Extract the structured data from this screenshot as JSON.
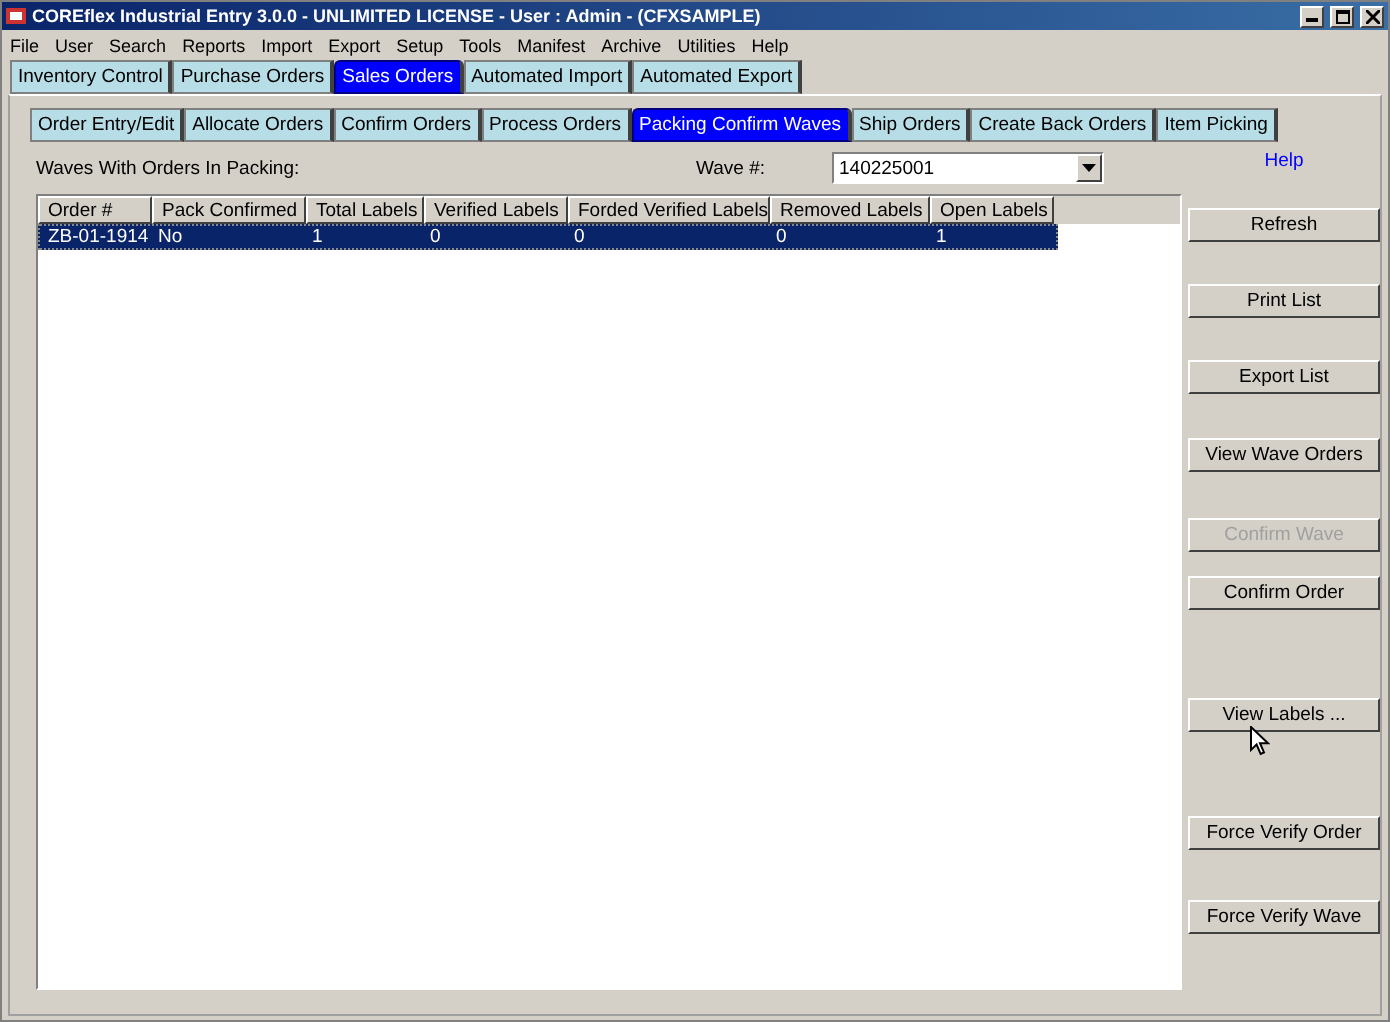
{
  "window": {
    "title": "COREflex Industrial Entry 3.0.0 - UNLIMITED LICENSE - User : Admin - (CFXSAMPLE)"
  },
  "menu": [
    "File",
    "User",
    "Search",
    "Reports",
    "Import",
    "Export",
    "Setup",
    "Tools",
    "Manifest",
    "Archive",
    "Utilities",
    "Help"
  ],
  "main_tabs": [
    {
      "label": "Inventory Control",
      "selected": false
    },
    {
      "label": "Purchase Orders",
      "selected": false
    },
    {
      "label": "Sales Orders",
      "selected": true
    },
    {
      "label": "Automated Import",
      "selected": false
    },
    {
      "label": "Automated Export",
      "selected": false
    }
  ],
  "sub_tabs": [
    {
      "label": "Order Entry/Edit",
      "selected": false
    },
    {
      "label": "Allocate Orders",
      "selected": false
    },
    {
      "label": "Confirm Orders",
      "selected": false
    },
    {
      "label": "Process Orders",
      "selected": false
    },
    {
      "label": "Packing Confirm Waves",
      "selected": true
    },
    {
      "label": "Ship Orders",
      "selected": false
    },
    {
      "label": "Create Back Orders",
      "selected": false
    },
    {
      "label": "Item Picking",
      "selected": false
    }
  ],
  "waves_label": "Waves With Orders In Packing:",
  "wave_field": {
    "label": "Wave #:",
    "value": "140225001"
  },
  "help_link": "Help",
  "table": {
    "columns": [
      "Order #",
      "Pack Confirmed",
      "Total Labels",
      "Verified Labels",
      "Forded Verified Labels",
      "Removed Labels",
      "Open Labels"
    ],
    "rows": [
      {
        "selected": true,
        "cells": [
          "ZB-01-1914",
          "No",
          "1",
          "0",
          "0",
          "0",
          "1"
        ]
      }
    ]
  },
  "buttons": [
    {
      "label": "Refresh",
      "disabled": false
    },
    {
      "label": "Print List",
      "disabled": false
    },
    {
      "label": "Export List",
      "disabled": false
    },
    {
      "label": "View Wave Orders",
      "disabled": false
    },
    {
      "label": "Confirm Wave",
      "disabled": true
    },
    {
      "label": "Confirm Order",
      "disabled": false
    },
    {
      "label": "View Labels ...",
      "disabled": false
    },
    {
      "label": "Force Verify Order",
      "disabled": false
    },
    {
      "label": "Force Verify Wave",
      "disabled": false
    }
  ]
}
